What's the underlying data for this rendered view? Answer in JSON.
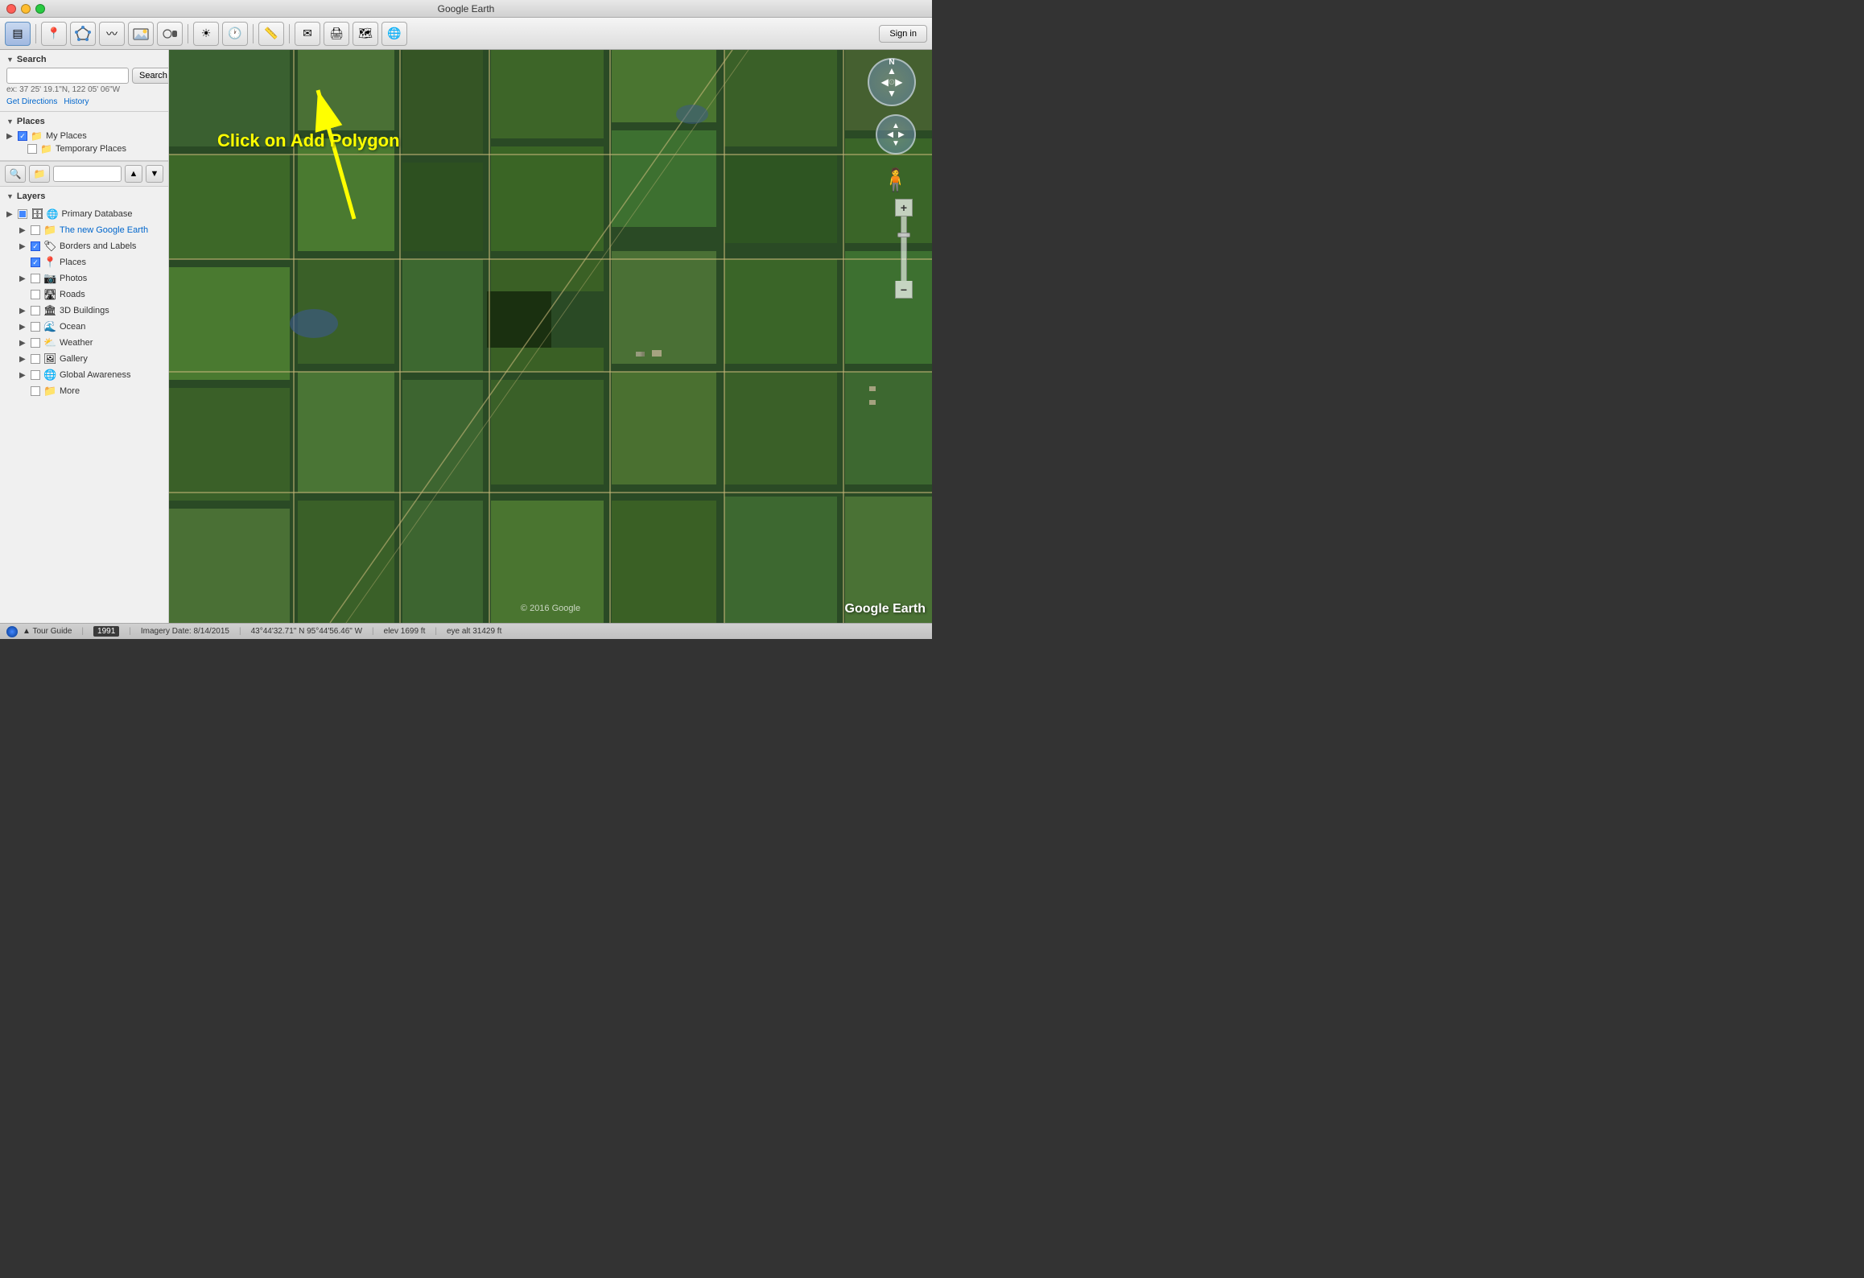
{
  "window": {
    "title": "Google Earth",
    "sign_in_label": "Sign in"
  },
  "toolbar": {
    "buttons": [
      {
        "name": "sidebar-toggle",
        "icon": "▤",
        "active": true
      },
      {
        "name": "add-placemark",
        "icon": "📍"
      },
      {
        "name": "add-polygon",
        "icon": "⬡"
      },
      {
        "name": "add-path",
        "icon": "〰"
      },
      {
        "name": "add-image-overlay",
        "icon": "🖼"
      },
      {
        "name": "record-tour",
        "icon": "▶"
      },
      {
        "name": "sun",
        "icon": "☀"
      },
      {
        "name": "historical-imagery",
        "icon": "🕐"
      },
      {
        "name": "ruler",
        "icon": "📏"
      },
      {
        "name": "email",
        "icon": "✉"
      },
      {
        "name": "print",
        "icon": "🖨"
      },
      {
        "name": "view-google-maps",
        "icon": "🗺"
      },
      {
        "name": "earth-view",
        "icon": "🌐"
      }
    ]
  },
  "search": {
    "label": "▼ Search",
    "placeholder": "",
    "button_label": "Search",
    "hint": "ex: 37 25' 19.1\"N, 122 05' 06\"W",
    "get_directions": "Get Directions",
    "history": "History"
  },
  "places": {
    "label": "▼ Places",
    "items": [
      {
        "name": "My Places",
        "checked": true,
        "type": "folder",
        "expanded": true
      },
      {
        "name": "Temporary Places",
        "checked": false,
        "type": "folder"
      }
    ]
  },
  "layers": {
    "label": "▼ Layers",
    "items": [
      {
        "name": "Primary Database",
        "checked": "partial",
        "type": "db",
        "indent": 0,
        "expanded": true
      },
      {
        "name": "The new Google Earth",
        "checked": false,
        "type": "link",
        "indent": 1,
        "link": true
      },
      {
        "name": "Borders and Labels",
        "checked": true,
        "type": "borders",
        "indent": 1
      },
      {
        "name": "Places",
        "checked": true,
        "type": "places",
        "indent": 1
      },
      {
        "name": "Photos",
        "checked": false,
        "type": "photos",
        "indent": 1
      },
      {
        "name": "Roads",
        "checked": false,
        "type": "roads",
        "indent": 1
      },
      {
        "name": "3D Buildings",
        "checked": false,
        "type": "buildings",
        "indent": 1
      },
      {
        "name": "Ocean",
        "checked": false,
        "type": "ocean",
        "indent": 1
      },
      {
        "name": "Weather",
        "checked": false,
        "type": "weather",
        "indent": 1
      },
      {
        "name": "Gallery",
        "checked": false,
        "type": "gallery",
        "indent": 1
      },
      {
        "name": "Global Awareness",
        "checked": false,
        "type": "global",
        "indent": 1
      },
      {
        "name": "More",
        "checked": false,
        "type": "more",
        "indent": 1
      }
    ]
  },
  "annotation": {
    "text": "Click on Add Polygon",
    "arrow": true
  },
  "map": {
    "copyright": "© 2016 Google",
    "watermark": "Google Earth"
  },
  "status_bar": {
    "tour_guide": "▲ Tour Guide",
    "year": "1991",
    "imagery_date": "Imagery Date: 8/14/2015",
    "coordinates": "43°44'32.71\" N   95°44'56.46\" W",
    "elevation": "elev 1699 ft",
    "eye_alt": "eye alt  31429 ft"
  }
}
